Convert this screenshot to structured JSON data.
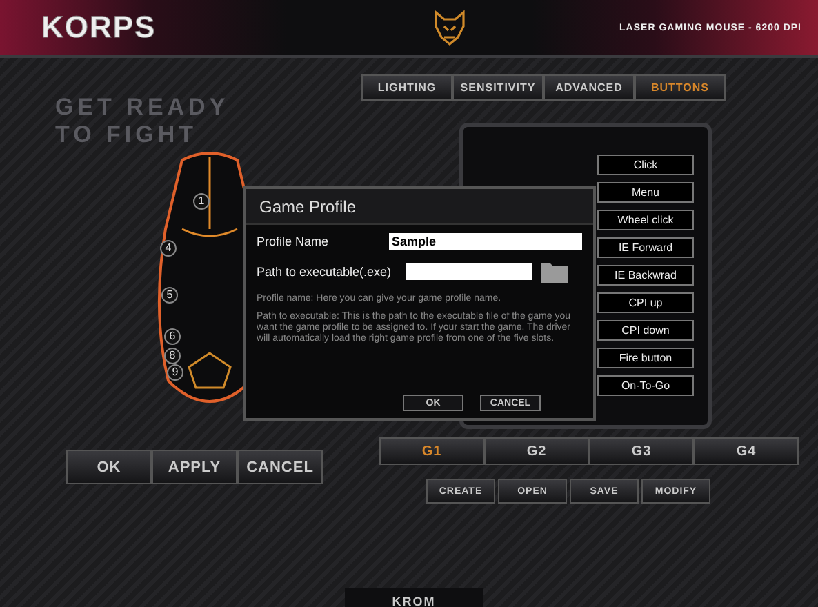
{
  "header": {
    "logo": "KORPS",
    "subtitle": "LASER GAMING MOUSE - 6200 DPI"
  },
  "slogan": [
    "GET READY",
    "TO FIGHT"
  ],
  "tabs": [
    {
      "label": "LIGHTING",
      "selected": false
    },
    {
      "label": "SENSITIVITY",
      "selected": false
    },
    {
      "label": "ADVANCED",
      "selected": false
    },
    {
      "label": "BUTTONS",
      "selected": true
    }
  ],
  "mouse_markers": [
    "1",
    "4",
    "5",
    "6",
    "8",
    "9"
  ],
  "dialog": {
    "title": "Game Profile",
    "name_label": "Profile Name",
    "name_value": "Sample",
    "path_label": "Path to executable(.exe)",
    "help_name": "Profile name: Here you can give your game profile name.",
    "help_path": "Path to executable: This is the path to the executable file of the game you want the game profile to be assigned to. If your start the game. The driver will automatically load the right game profile from one of the five slots.",
    "buttons": [
      "OK",
      "CANCEL"
    ]
  },
  "button_assignments": [
    "Click",
    "Menu",
    "Wheel click",
    "IE Forward",
    "IE Backwrad",
    "CPI up",
    "CPI down",
    "Fire button",
    "On-To-Go"
  ],
  "profiles": [
    {
      "label": "G1",
      "selected": true
    },
    {
      "label": "G2",
      "selected": false
    },
    {
      "label": "G3",
      "selected": false
    },
    {
      "label": "G4",
      "selected": false
    }
  ],
  "main_buttons": [
    "OK",
    "APPLY",
    "CANCEL"
  ],
  "profile_actions": [
    "CREATE",
    "OPEN",
    "SAVE",
    "MODIFY"
  ],
  "footer_logo": "KROM"
}
